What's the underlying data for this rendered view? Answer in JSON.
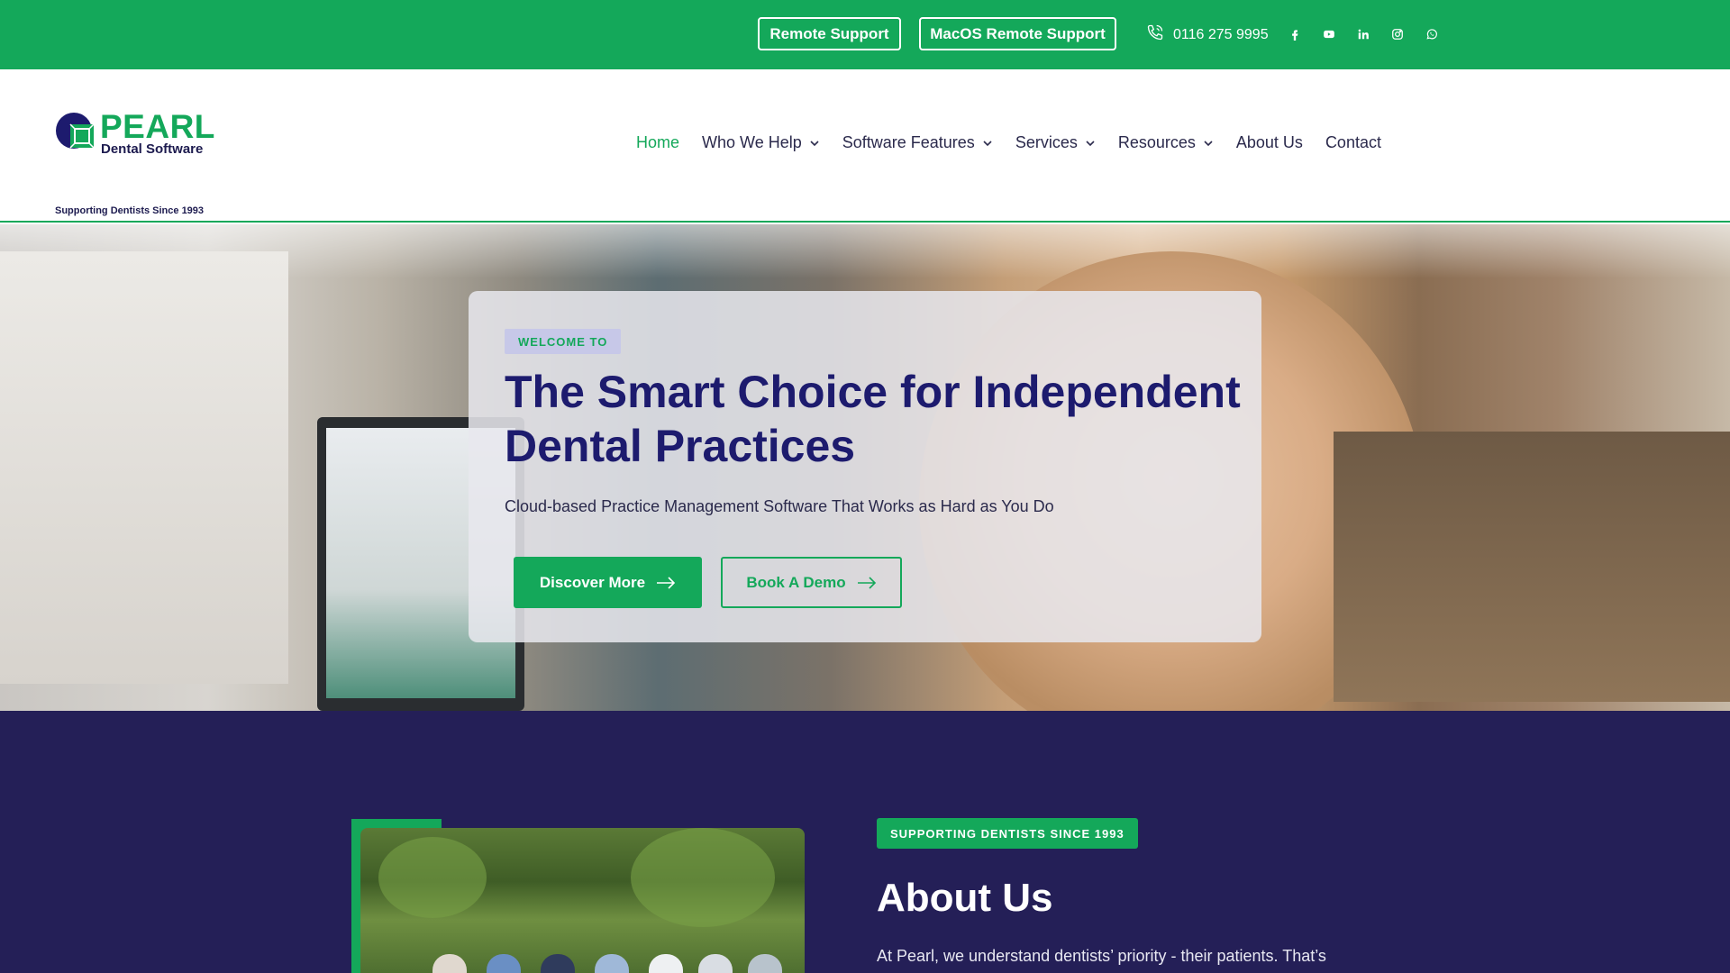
{
  "topbar": {
    "remote_support": "Remote Support",
    "macos_remote_support": "MacOS Remote Support",
    "phone": "0116 275 9995",
    "social_icons": [
      "facebook-icon",
      "youtube-icon",
      "linkedin-icon",
      "instagram-icon",
      "whatsapp-icon"
    ]
  },
  "logo": {
    "name": "PEARL",
    "subtitle": "Dental Software",
    "tagline": "Supporting Dentists Since 1993"
  },
  "nav": {
    "items": [
      {
        "label": "Home",
        "active": true,
        "dropdown": false
      },
      {
        "label": "Who We Help",
        "active": false,
        "dropdown": true
      },
      {
        "label": "Software Features",
        "active": false,
        "dropdown": true
      },
      {
        "label": "Services",
        "active": false,
        "dropdown": true
      },
      {
        "label": "Resources",
        "active": false,
        "dropdown": true
      },
      {
        "label": "About Us",
        "active": false,
        "dropdown": false
      },
      {
        "label": "Contact",
        "active": false,
        "dropdown": false
      }
    ]
  },
  "hero": {
    "eyebrow": "WELCOME TO",
    "title": "The Smart Choice for Independent Dental Practices",
    "subtitle": "Cloud-based Practice Management Software That Works as Hard as You Do",
    "primary_button": "Discover More",
    "secondary_button": "Book A Demo"
  },
  "about": {
    "badge": "SUPPORTING DENTISTS SINCE 1993",
    "title": "About Us",
    "text": "At Pearl, we understand dentists’ priority - their patients. That’s"
  },
  "colors": {
    "brand_green": "#14a85a",
    "navy": "#1d1b6e",
    "about_bg": "#241f57"
  }
}
